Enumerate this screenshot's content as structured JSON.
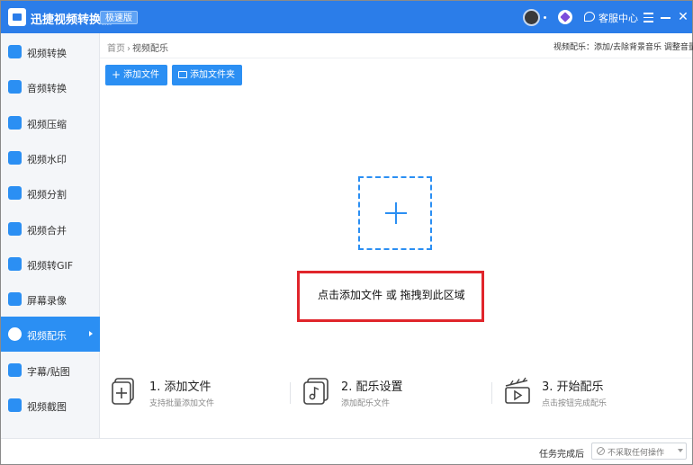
{
  "titlebar": {
    "app_title": "迅捷视频转换器",
    "edition_badge": "极速版",
    "service_label": "客服中心"
  },
  "sidebar": {
    "items": [
      {
        "label": "视频转换",
        "icon": "video-convert-icon",
        "color": "#2b8ff3"
      },
      {
        "label": "音频转换",
        "icon": "audio-convert-icon",
        "color": "#2b8ff3"
      },
      {
        "label": "视频压缩",
        "icon": "video-compress-icon",
        "color": "#2b8ff3"
      },
      {
        "label": "视频水印",
        "icon": "video-watermark-icon",
        "color": "#2b8ff3"
      },
      {
        "label": "视频分割",
        "icon": "video-split-icon",
        "color": "#2b8ff3"
      },
      {
        "label": "视频合并",
        "icon": "video-merge-icon",
        "color": "#2b8ff3"
      },
      {
        "label": "视频转GIF",
        "icon": "video-to-gif-icon",
        "color": "#2b8ff3"
      },
      {
        "label": "屏幕录像",
        "icon": "screen-record-icon",
        "color": "#2b8ff3"
      },
      {
        "label": "视频配乐",
        "icon": "video-music-icon",
        "color": "#ffffff",
        "active": true
      },
      {
        "label": "字幕/贴图",
        "icon": "subtitle-sticker-icon",
        "color": "#2b8ff3"
      },
      {
        "label": "视频截图",
        "icon": "video-screenshot-icon",
        "color": "#2b8ff3"
      }
    ]
  },
  "breadcrumb": {
    "home": "首页",
    "separator": "›",
    "current": "视频配乐"
  },
  "header": {
    "description": "视频配乐：添加/去除背景音乐 调整音量"
  },
  "toolbar": {
    "add_file_label": "添加文件",
    "add_folder_label": "添加文件夹"
  },
  "dropzone": {
    "hint": "点击添加文件 或 拖拽到此区域",
    "highlight_color": "#e0252b"
  },
  "steps": [
    {
      "title": "1. 添加文件",
      "desc": "支持批量添加文件",
      "icon": "add-file-icon"
    },
    {
      "title": "2. 配乐设置",
      "desc": "添加配乐文件",
      "icon": "music-settings-icon"
    },
    {
      "title": "3. 开始配乐",
      "desc": "点击按钮完成配乐",
      "icon": "start-icon"
    }
  ],
  "footer": {
    "after_task_label": "任务完成后",
    "after_task_value": "不采取任何操作"
  },
  "colors": {
    "accent": "#2b8ff3",
    "titlebar": "#2b7de9"
  }
}
